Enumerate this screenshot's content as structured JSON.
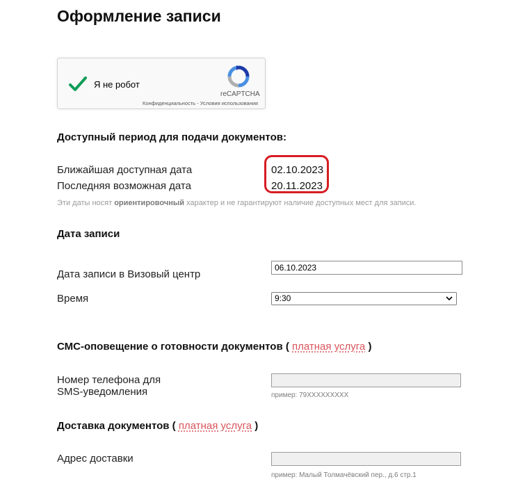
{
  "page": {
    "title": "Оформление записи"
  },
  "captcha": {
    "label": "Я не робот",
    "brand": "reCAPTCHA",
    "privacy_link": "Конфиденциальность",
    "separator": "-",
    "terms_link": "Условия использования"
  },
  "period": {
    "heading": "Доступный период для подачи документов:",
    "earliest_label": "Ближайшая доступная дата",
    "earliest_value": "02.10.2023",
    "latest_label": "Последняя возможная дата",
    "latest_value": "20.11.2023",
    "note_prefix": "Эти даты носят",
    "note_bold": "ориентировочный",
    "note_suffix": "характер и не гарантируют наличие доступных мест для записи."
  },
  "appointment": {
    "heading": "Дата записи",
    "date_label": "Дата записи в Визовый центр",
    "date_value": "06.10.2023",
    "time_label": "Время",
    "time_value": "9:30"
  },
  "sms": {
    "heading": "СМС-оповещение о готовности документов (",
    "paid_link": "платная услуга",
    "heading_close": ")",
    "phone_label_line1": "Номер телефона для",
    "phone_label_line2": "SMS-уведомления",
    "phone_value": "",
    "phone_hint": "пример: 79XXXXXXXXX"
  },
  "delivery": {
    "heading": "Доставка документов (",
    "paid_link": "платная услуга",
    "heading_close": ")",
    "address_label": "Адрес доставки",
    "address_value": "",
    "address_hint": "пример: Малый Толмачёвский пер., д.6 стр.1"
  },
  "colors": {
    "highlight": "#d61c24",
    "paid_link": "#d9545b",
    "captcha_check": "#0f9d58"
  },
  "icons": {
    "captcha_check": "check-icon",
    "captcha_logo": "recaptcha-logo-icon",
    "select_arrow": "chevron-down-icon"
  }
}
